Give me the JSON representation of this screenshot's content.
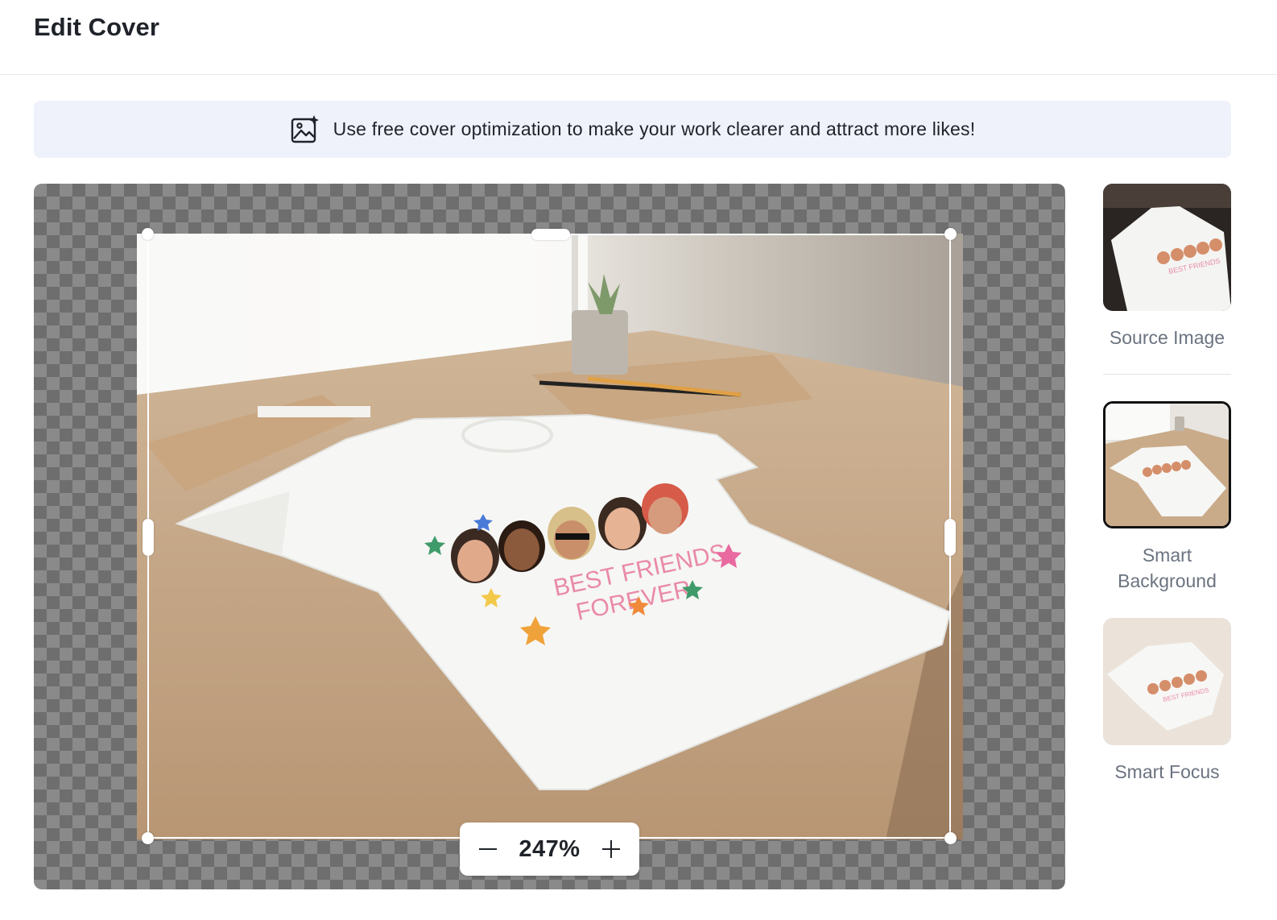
{
  "header": {
    "title": "Edit Cover"
  },
  "banner": {
    "icon": "image-sparkle-icon",
    "text": "Use free cover optimization to make your work clearer and attract more likes!"
  },
  "editor": {
    "zoom": {
      "value": "247%",
      "decrease_icon": "minus-icon",
      "increase_icon": "plus-icon"
    },
    "image_alt": "White t-shirt with BEST FRIENDS FOREVER print on a wooden desk"
  },
  "options": [
    {
      "label": "Source Image",
      "selected": false
    },
    {
      "label": "Smart Background",
      "selected": true
    },
    {
      "label": "Smart Focus",
      "selected": false
    }
  ],
  "shirt_print": {
    "line1": "BEST FRIENDS",
    "line2": "FOREVER"
  },
  "colors": {
    "banner_bg": "#eff2fb",
    "label_text": "#6b7380",
    "selected_border": "#111111"
  }
}
